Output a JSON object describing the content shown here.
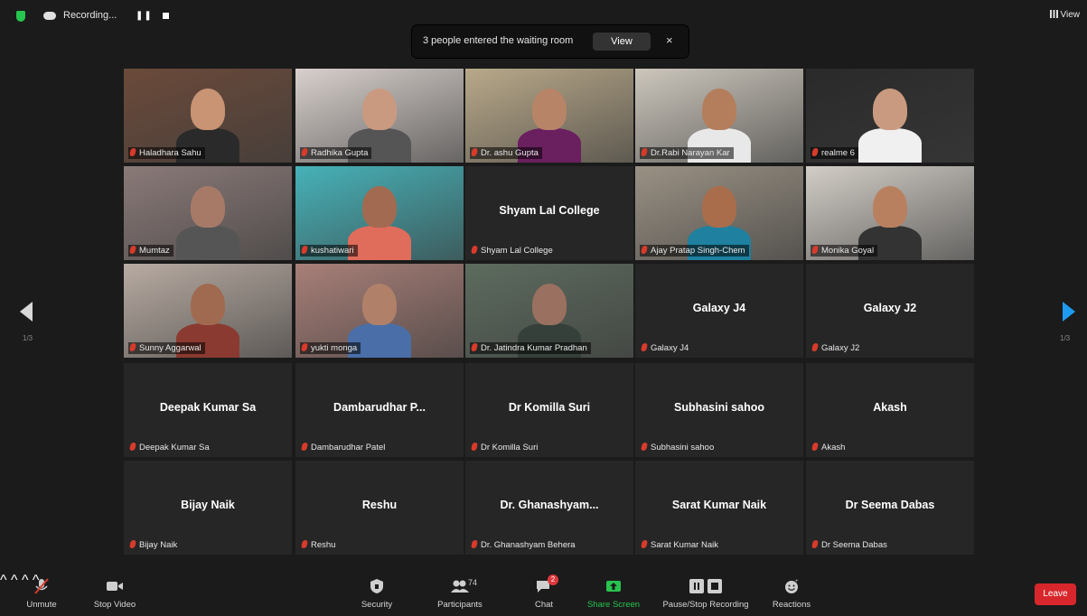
{
  "topbar": {
    "recording_label": "Recording...",
    "pause_glyph": "❚❚",
    "view_label": "View",
    "icons": [
      "shield-icon",
      "cloud-recording-icon",
      "pause-icon",
      "stop-icon",
      "grid-view-icon"
    ]
  },
  "notification": {
    "text": "3 people entered the waiting room",
    "view_button": "View",
    "close_glyph": "×"
  },
  "gallery": {
    "page_left": "1/3",
    "page_right": "1/3",
    "tiles": [
      {
        "name": "Haladhara Sahu",
        "type": "video",
        "bg": "#6b4a3a",
        "skin": "#c89474",
        "shirt": "#2a2a2a"
      },
      {
        "name": "Radhika Gupta",
        "type": "video",
        "bg": "#d8d0cc",
        "skin": "#c99a80",
        "shirt": "#555"
      },
      {
        "name": "Dr. ashu Gupta",
        "type": "video",
        "bg": "#b9a98a",
        "skin": "#b88468",
        "shirt": "#6a1f5f"
      },
      {
        "name": "Dr.Rabi Narayan Kar",
        "type": "video",
        "bg": "#ccc6bc",
        "skin": "#b47e5c",
        "shirt": "#e8e8e8",
        "active": true
      },
      {
        "name": "realme 6",
        "type": "video",
        "bg": "#2a2a2a",
        "skin": "#c99a80",
        "shirt": "#f0f0f0"
      },
      {
        "name": "Mumtaz",
        "type": "video",
        "bg": "#8a7a78",
        "skin": "#a77a68",
        "shirt": "#555"
      },
      {
        "name": "kushatiwari",
        "type": "video",
        "bg": "#46b2b8",
        "skin": "#a26a50",
        "shirt": "#e06c5c"
      },
      {
        "name": "Shyam Lal College",
        "type": "name",
        "title": "Shyam Lal College"
      },
      {
        "name": "Ajay Pratap Singh-Chem",
        "type": "video",
        "bg": "#9a9184",
        "skin": "#a96d4c",
        "shirt": "#1f80a0"
      },
      {
        "name": "Monika Goyal",
        "type": "video",
        "bg": "#d2cdc6",
        "skin": "#b98060",
        "shirt": "#333"
      },
      {
        "name": "Sunny Aggarwal",
        "type": "video",
        "bg": "#b8aba2",
        "skin": "#a06a50",
        "shirt": "#8a3a30"
      },
      {
        "name": "yukti monga",
        "type": "video",
        "bg": "#a87f78",
        "skin": "#b08068",
        "shirt": "#4a6fa8"
      },
      {
        "name": "Dr. Jatindra Kumar Pradhan",
        "type": "video",
        "bg": "#5d6b5e",
        "skin": "#9a7060",
        "shirt": "#36403a"
      },
      {
        "name": "Galaxy J4",
        "type": "name",
        "title": "Galaxy J4"
      },
      {
        "name": "Galaxy J2",
        "type": "name",
        "title": "Galaxy J2"
      },
      {
        "name": "Deepak Kumar Sa",
        "type": "name",
        "title": "Deepak Kumar Sa"
      },
      {
        "name": "Dambarudhar Patel",
        "type": "name",
        "title": "Dambarudhar  P..."
      },
      {
        "name": "Dr Komilla Suri",
        "type": "name",
        "title": "Dr Komilla Suri"
      },
      {
        "name": "Subhasini sahoo",
        "type": "name",
        "title": "Subhasini sahoo"
      },
      {
        "name": "Akash",
        "type": "name",
        "title": "Akash"
      },
      {
        "name": "Bijay Naik",
        "type": "name",
        "title": "Bijay Naik"
      },
      {
        "name": "Reshu",
        "type": "name",
        "title": "Reshu"
      },
      {
        "name": "Dr. Ghanashyam Behera",
        "type": "name",
        "title": "Dr. Ghanashyam..."
      },
      {
        "name": "Sarat Kumar Naik",
        "type": "name",
        "title": "Sarat Kumar Naik"
      },
      {
        "name": "Dr Seema Dabas",
        "type": "name",
        "title": "Dr Seema Dabas"
      }
    ]
  },
  "toolbar": {
    "unmute": "Unmute",
    "stop_video": "Stop Video",
    "security": "Security",
    "participants": "Participants",
    "participants_count": "74",
    "chat": "Chat",
    "chat_badge": "2",
    "share_screen": "Share Screen",
    "pause_stop_recording": "Pause/Stop Recording",
    "reactions": "Reactions",
    "leave": "Leave",
    "caret": "^",
    "colors": {
      "share": "#27c44f",
      "leave": "#d8272c",
      "mic_muted": "#d83b2b",
      "active_speaker": "#b8e03a"
    }
  }
}
